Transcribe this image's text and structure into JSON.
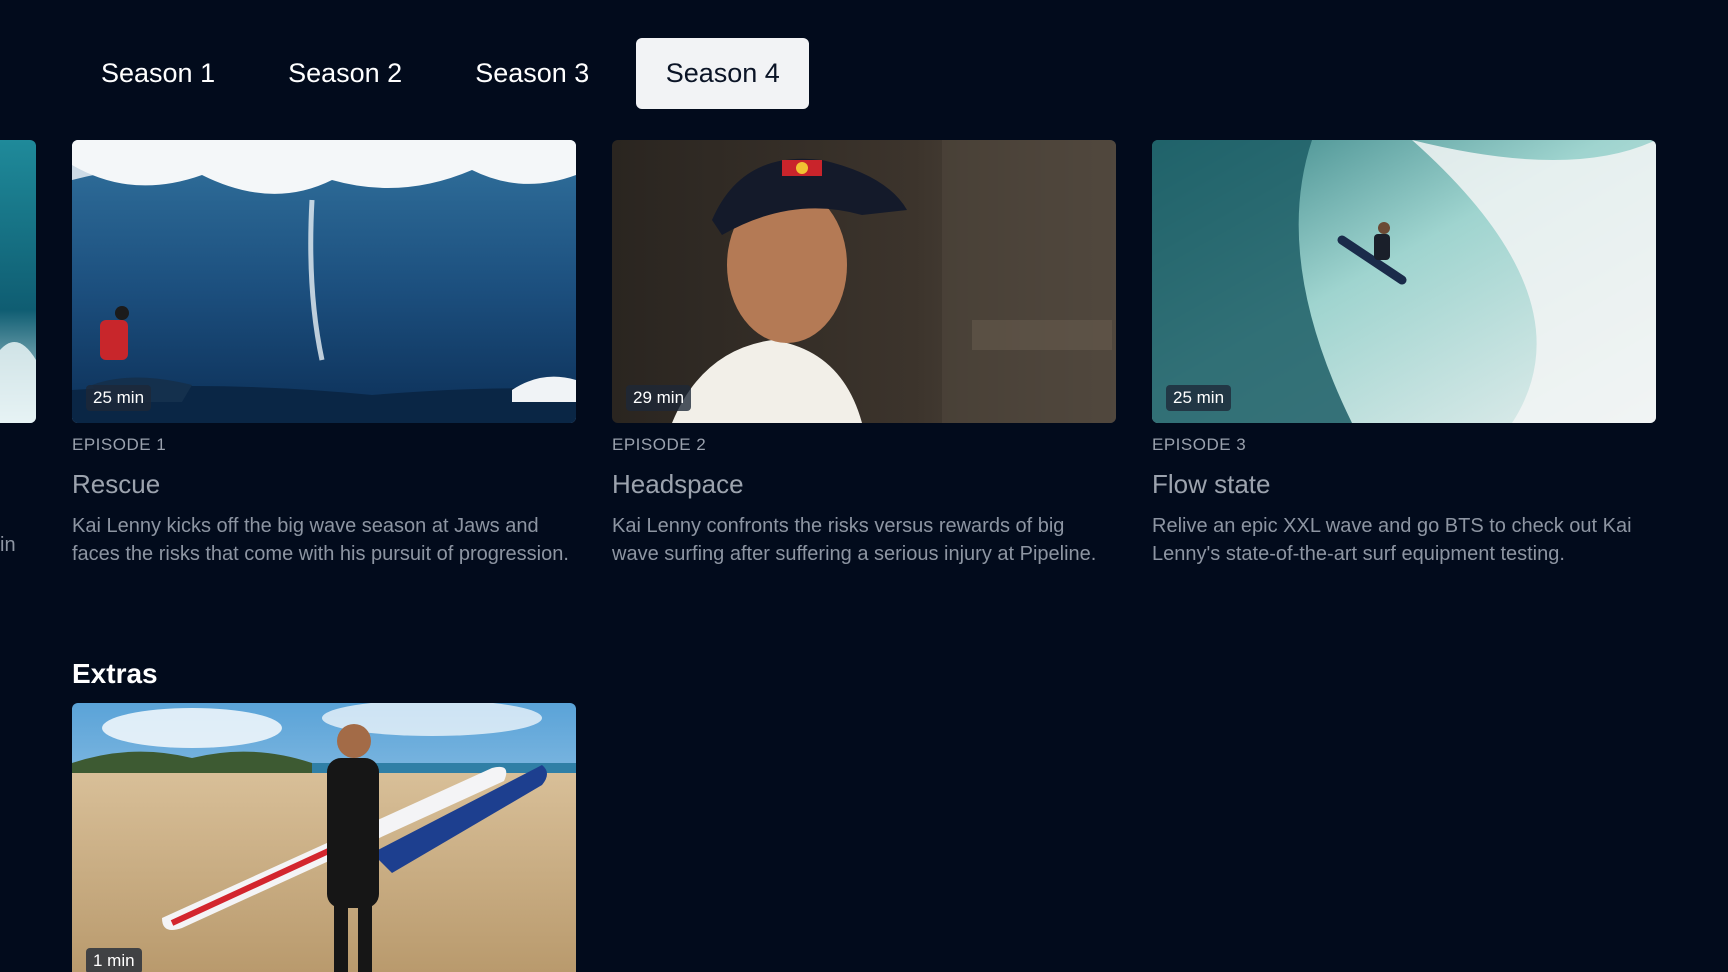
{
  "seasons": {
    "tabs": [
      {
        "label": "Season 1"
      },
      {
        "label": "Season 2"
      },
      {
        "label": "Season 3"
      },
      {
        "label": "Season 4",
        "selected": true
      }
    ]
  },
  "previous_peek": {
    "text_fragment": "in"
  },
  "episodes": [
    {
      "number_label": "EPISODE 1",
      "title": "Rescue",
      "duration": "25 min",
      "description": "Kai Lenny kicks off the big wave season at Jaws and faces the risks that come with his pursuit of progression.",
      "thumbnail": "big-wave-jetski"
    },
    {
      "number_label": "EPISODE 2",
      "title": "Headspace",
      "duration": "29 min",
      "description": "Kai Lenny confronts the risks versus rewards of big wave surfing after suffering a serious injury at Pipeline.",
      "thumbnail": "portrait-cap"
    },
    {
      "number_label": "EPISODE 3",
      "title": "Flow state",
      "duration": "25 min",
      "description": "Relive an epic XXL wave and go BTS to check out Kai Lenny's state-of-the-art surf equipment testing.",
      "thumbnail": "aerial-surf"
    }
  ],
  "extras": {
    "heading": "Extras",
    "items": [
      {
        "duration": "1 min",
        "thumbnail": "beach-surfboard"
      }
    ]
  },
  "colors": {
    "background": "#020b1c",
    "tab_active_bg": "#f2f3f5",
    "tab_active_text": "#0b1426",
    "muted_text": "#8d95a2"
  }
}
